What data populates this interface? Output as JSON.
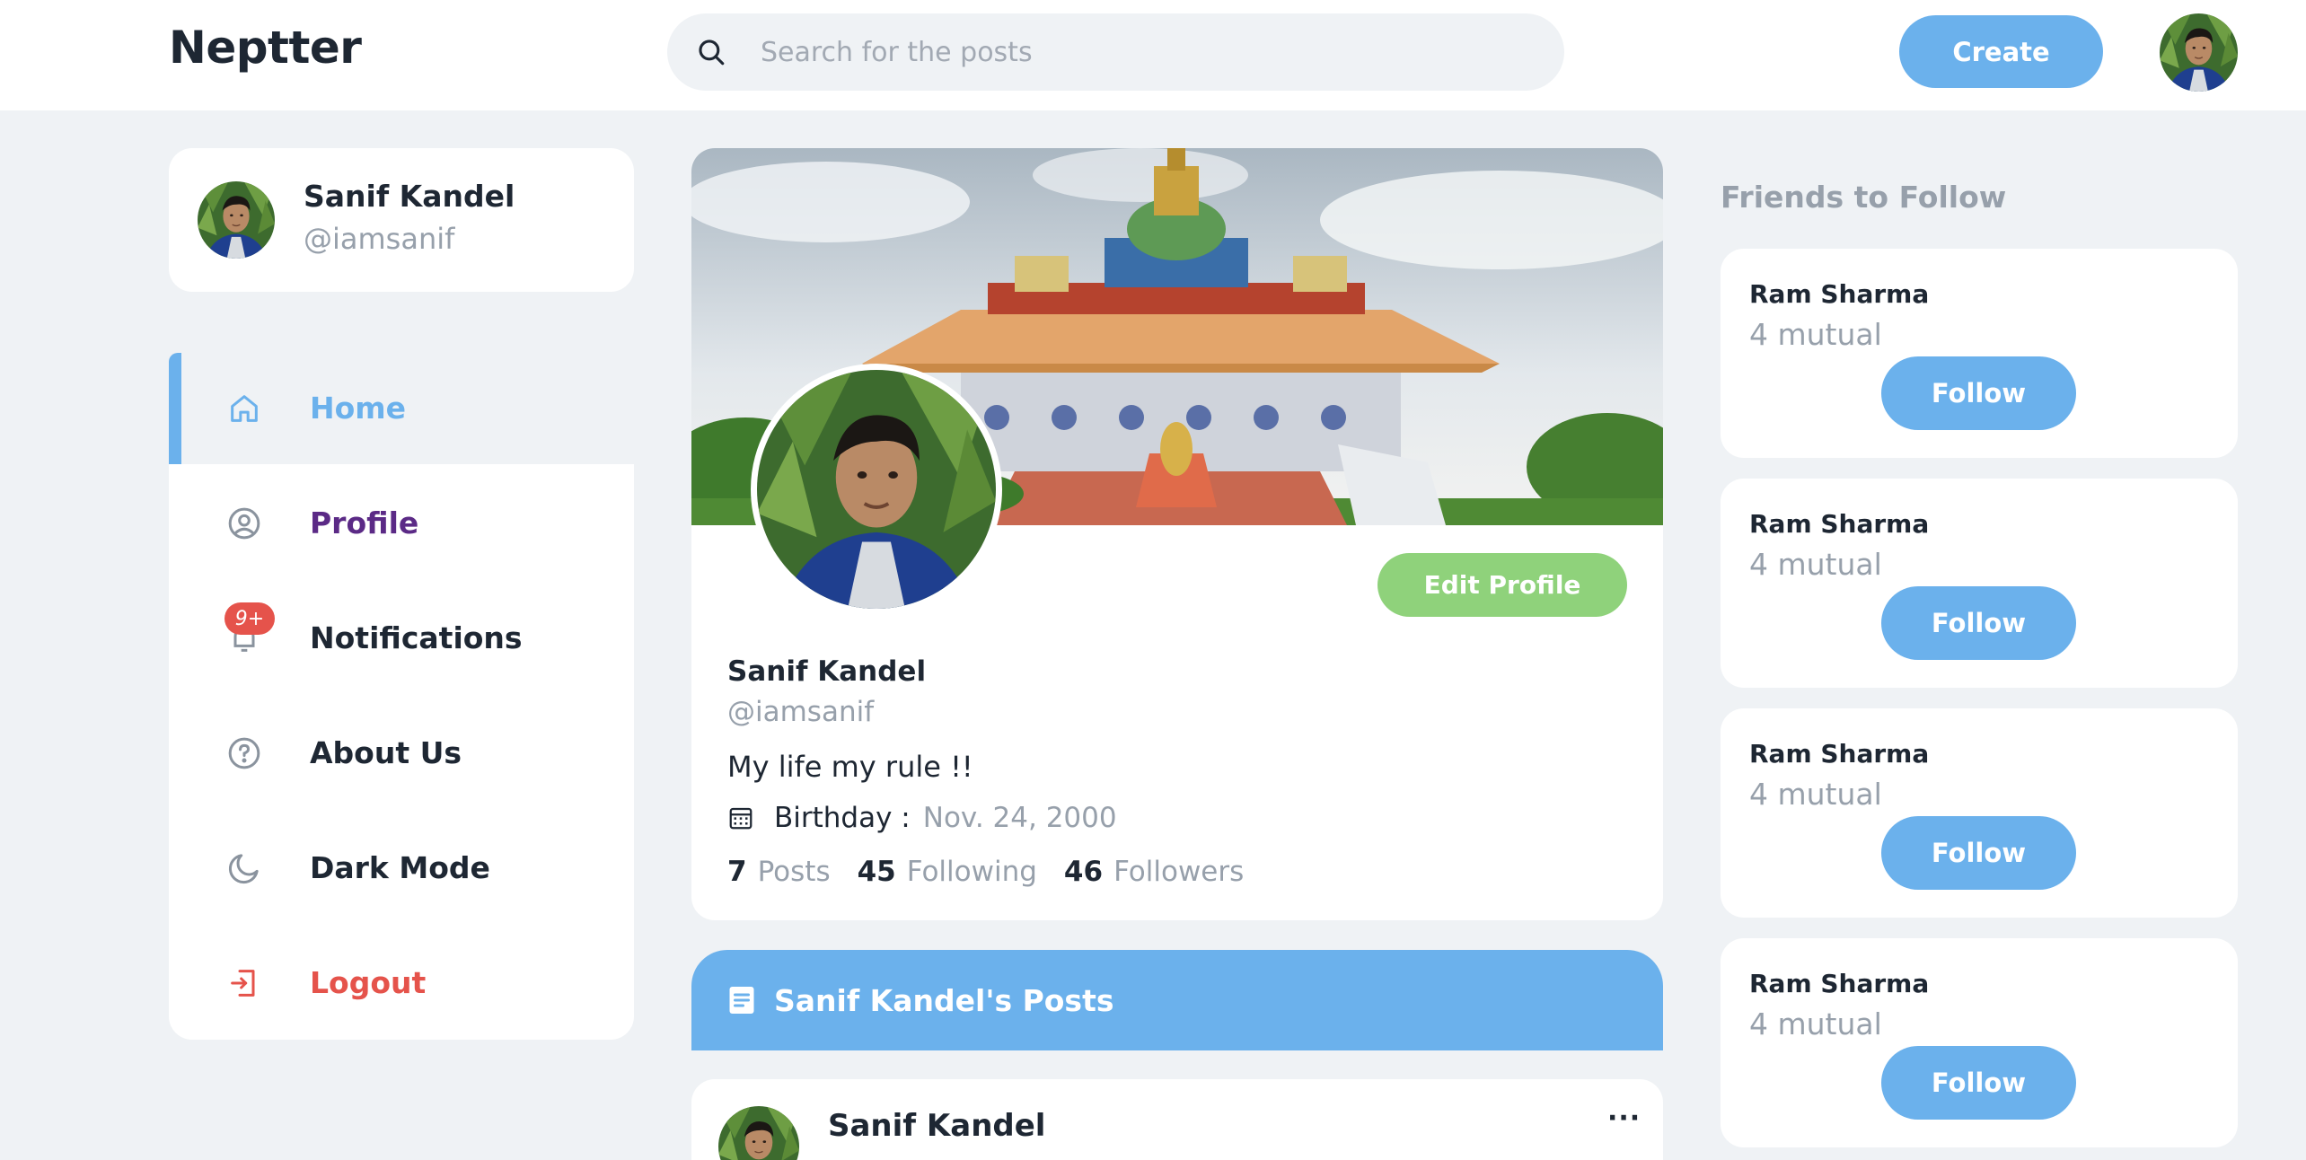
{
  "header": {
    "brand": "Neptter",
    "search_placeholder": "Search for the posts",
    "create_label": "Create"
  },
  "user": {
    "name": "Sanif Kandel",
    "handle": "@iamsanif"
  },
  "nav": {
    "items": [
      {
        "label": "Home",
        "icon": "home-icon",
        "color": "#6bb1ec"
      },
      {
        "label": "Profile",
        "icon": "user-circle-icon",
        "color": "#5b2a86"
      },
      {
        "label": "Notifications",
        "icon": "bell-icon",
        "color": "#1e2733"
      },
      {
        "label": "About Us",
        "icon": "question-circle-icon",
        "color": "#1e2733"
      },
      {
        "label": "Dark Mode",
        "icon": "moon-icon",
        "color": "#1e2733"
      },
      {
        "label": "Logout",
        "icon": "logout-icon",
        "color": "#e5534b"
      }
    ],
    "notification_badge": "9+"
  },
  "profile": {
    "name": "Sanif Kandel",
    "handle": "@iamsanif",
    "bio": "My life my rule !!",
    "birthday_label": "Birthday :",
    "birthday_value": "Nov. 24, 2000",
    "edit_label": "Edit Profile",
    "stats": {
      "posts_count": "7",
      "posts_label": "Posts",
      "following_count": "45",
      "following_label": "Following",
      "followers_count": "46",
      "followers_label": "Followers"
    }
  },
  "posts_section": {
    "title": "Sanif Kandel's Posts",
    "first_post_author": "Sanif Kandel",
    "more_label": "···"
  },
  "friends": {
    "title": "Friends to Follow",
    "follow_label": "Follow",
    "items": [
      {
        "name": "Ram Sharma",
        "mutual": "4 mutual"
      },
      {
        "name": "Ram Sharma",
        "mutual": "4 mutual"
      },
      {
        "name": "Ram Sharma",
        "mutual": "4 mutual"
      },
      {
        "name": "Ram Sharma",
        "mutual": "4 mutual"
      }
    ]
  },
  "colors": {
    "accent": "#6bb1ec",
    "success": "#8fd27b",
    "danger": "#e5534b",
    "muted": "#97a0ab"
  }
}
